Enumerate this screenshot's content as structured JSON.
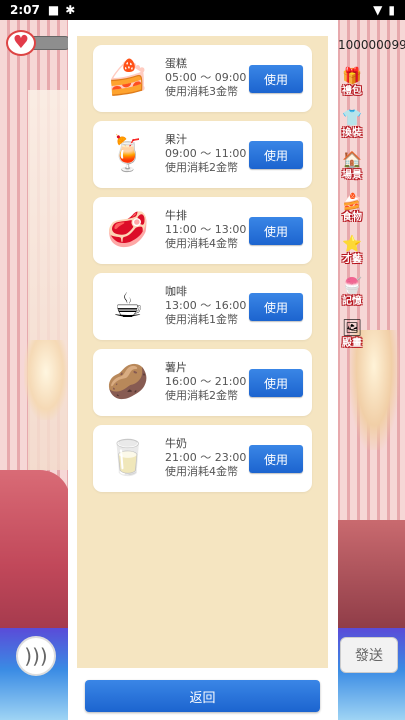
{
  "status_bar": {
    "time": "2:07",
    "icons": [
      "notification-square-icon",
      "bug-icon"
    ],
    "right_icons": [
      "wifi-icon",
      "battery-icon"
    ]
  },
  "hud": {
    "coin_count": "100000099",
    "heart_icon": "heart-icon"
  },
  "side_menu": [
    {
      "key": "gift",
      "label": "禮包",
      "icon": "gift-icon",
      "glyph": "🎁"
    },
    {
      "key": "outfit",
      "label": "換裝",
      "icon": "hanger-icon",
      "glyph": "👕"
    },
    {
      "key": "scene",
      "label": "場景",
      "icon": "house-icon",
      "glyph": "🏠"
    },
    {
      "key": "food",
      "label": "食物",
      "icon": "food-icon",
      "glyph": "🍰"
    },
    {
      "key": "talent",
      "label": "才藝",
      "icon": "star-icon",
      "glyph": "⭐"
    },
    {
      "key": "memory",
      "label": "記憶",
      "icon": "memory-icon",
      "glyph": "🍧"
    },
    {
      "key": "shop",
      "label": "殿畫",
      "icon": "picture-icon",
      "glyph": "🖼"
    }
  ],
  "food_list": [
    {
      "name": "蛋糕",
      "time": "05:00 ～ 09:00",
      "cost": "使用消耗3金幣",
      "icon": "cake-icon",
      "glyph": "🍰",
      "button": "使用"
    },
    {
      "name": "果汁",
      "time": "09:00 ～ 11:00",
      "cost": "使用消耗2金幣",
      "icon": "juice-icon",
      "glyph": "🍹",
      "button": "使用"
    },
    {
      "name": "牛排",
      "time": "11:00 ～ 13:00",
      "cost": "使用消耗4金幣",
      "icon": "steak-icon",
      "glyph": "🥩",
      "button": "使用"
    },
    {
      "name": "咖啡",
      "time": "13:00 ～ 16:00",
      "cost": "使用消耗1金幣",
      "icon": "coffee-icon",
      "glyph": "☕",
      "button": "使用"
    },
    {
      "name": "薯片",
      "time": "16:00 ～ 21:00",
      "cost": "使用消耗2金幣",
      "icon": "chips-icon",
      "glyph": "🥔",
      "button": "使用"
    },
    {
      "name": "牛奶",
      "time": "21:00 ～ 23:00",
      "cost": "使用消耗4金幣",
      "icon": "milk-icon",
      "glyph": "🥛",
      "button": "使用"
    }
  ],
  "back_button": "返回",
  "chat": {
    "voice_icon": "voice-wave-icon",
    "send_label": "發送"
  },
  "colors": {
    "button_blue": "#1c64cf",
    "panel_beige": "#f5e5c1"
  }
}
